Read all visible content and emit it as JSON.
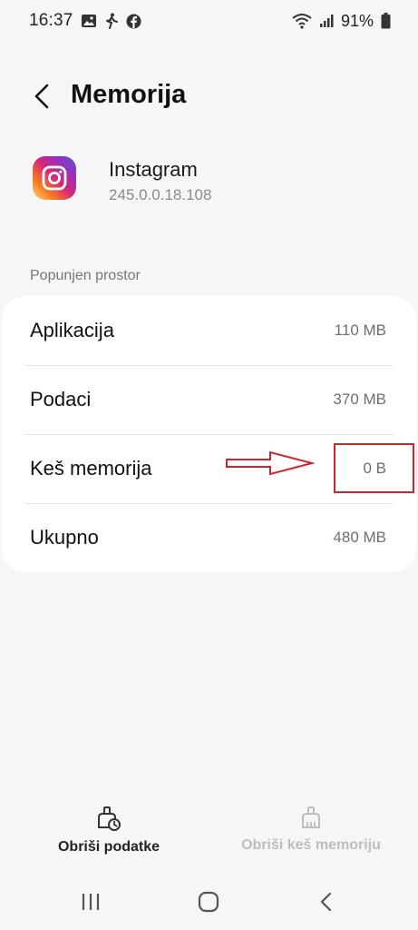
{
  "status_bar": {
    "time": "16:37",
    "battery_percent": "91%",
    "icons_left": [
      "gallery-icon",
      "walking-icon",
      "facebook-icon"
    ],
    "icons_right": [
      "wifi-icon",
      "signal-icon",
      "battery-icon"
    ]
  },
  "header": {
    "title": "Memorija"
  },
  "app": {
    "name": "Instagram",
    "version": "245.0.0.18.108",
    "icon": "instagram-icon"
  },
  "storage": {
    "section_label": "Popunjen prostor",
    "rows": [
      {
        "label": "Aplikacija",
        "value": "110 MB"
      },
      {
        "label": "Podaci",
        "value": "370 MB"
      },
      {
        "label": "Keš memorija",
        "value": "0 B"
      },
      {
        "label": "Ukupno",
        "value": "480 MB"
      }
    ]
  },
  "actions": {
    "clear_data": {
      "label": "Obriši podatke",
      "icon": "clear-data-icon",
      "enabled": true
    },
    "clear_cache": {
      "label": "Obriši keš memoriju",
      "icon": "clear-cache-icon",
      "enabled": false
    }
  },
  "annotation_color": "#d1232a",
  "nav_bar": [
    "recents-icon",
    "home-icon",
    "back-icon"
  ]
}
